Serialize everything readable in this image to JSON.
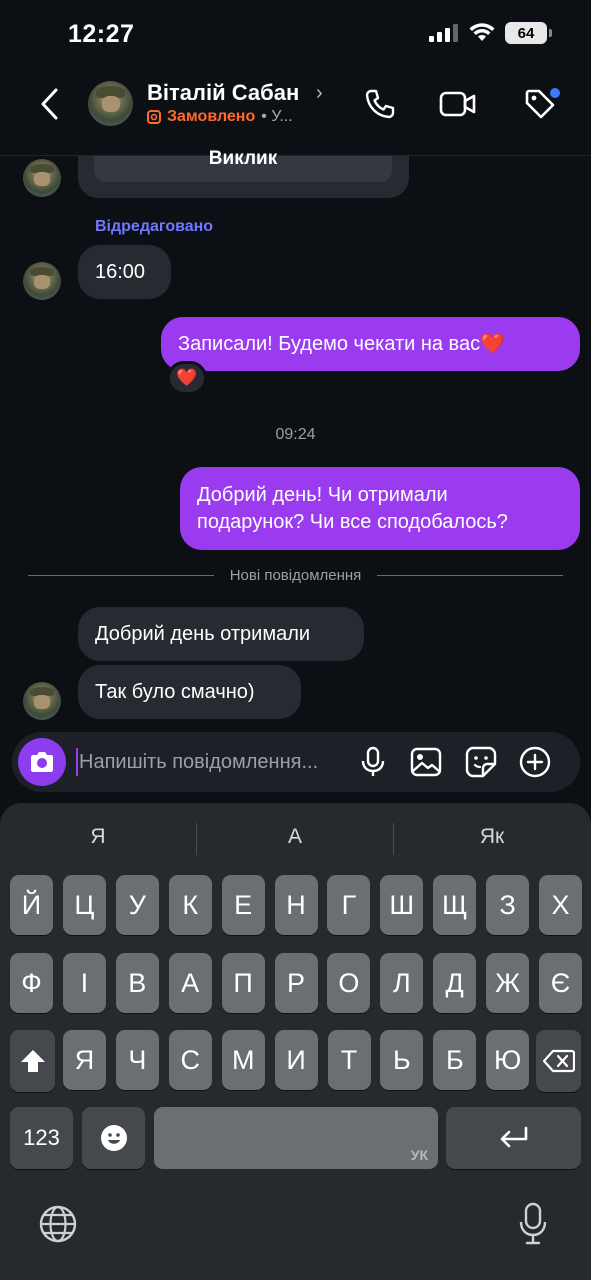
{
  "status_bar": {
    "time": "12:27",
    "battery": "64"
  },
  "header": {
    "contact_name": "Віталій Сабан",
    "order_status": "Замовлено",
    "sub_extra": "• У..."
  },
  "messages": {
    "call_label": "Виклик",
    "edited_label": "Відредаговано",
    "in_1": "16:00",
    "out_1": "Записали! Будемо чекати на вас❤️",
    "reaction": "❤️",
    "time_separator": "09:24",
    "out_2_line1": "Добрий день! Чи отримали",
    "out_2_line2": "подарунок? Чи все сподобалось?",
    "new_messages_label": "Нові повідомлення",
    "in_2": "Добрий день отримали",
    "in_3": "Так було смачно)"
  },
  "composer": {
    "placeholder": "Напишіть повідомлення..."
  },
  "keyboard": {
    "suggestions": [
      "Я",
      "А",
      "Як"
    ],
    "row1": [
      "Й",
      "Ц",
      "У",
      "К",
      "Е",
      "Н",
      "Г",
      "Ш",
      "Щ",
      "З",
      "Х"
    ],
    "row2": [
      "Ф",
      "І",
      "В",
      "А",
      "П",
      "Р",
      "О",
      "Л",
      "Д",
      "Ж",
      "Є"
    ],
    "row3": [
      "Я",
      "Ч",
      "С",
      "М",
      "И",
      "Т",
      "Ь",
      "Б",
      "Ю"
    ],
    "numbers_key": "123",
    "space_lang": "УК"
  },
  "colors": {
    "accent_purple": "#9b3bf0",
    "order_orange": "#ff6a2b",
    "edited_blue": "#6f78ff",
    "badge_blue": "#3a7bff"
  },
  "icons": [
    "back-chevron-icon",
    "phone-icon",
    "video-icon",
    "tag-icon",
    "camera-icon",
    "microphone-icon",
    "image-icon",
    "sticker-icon",
    "plus-icon",
    "shift-icon",
    "backspace-icon",
    "emoji-icon",
    "return-icon",
    "globe-icon",
    "dictation-mic-icon"
  ]
}
